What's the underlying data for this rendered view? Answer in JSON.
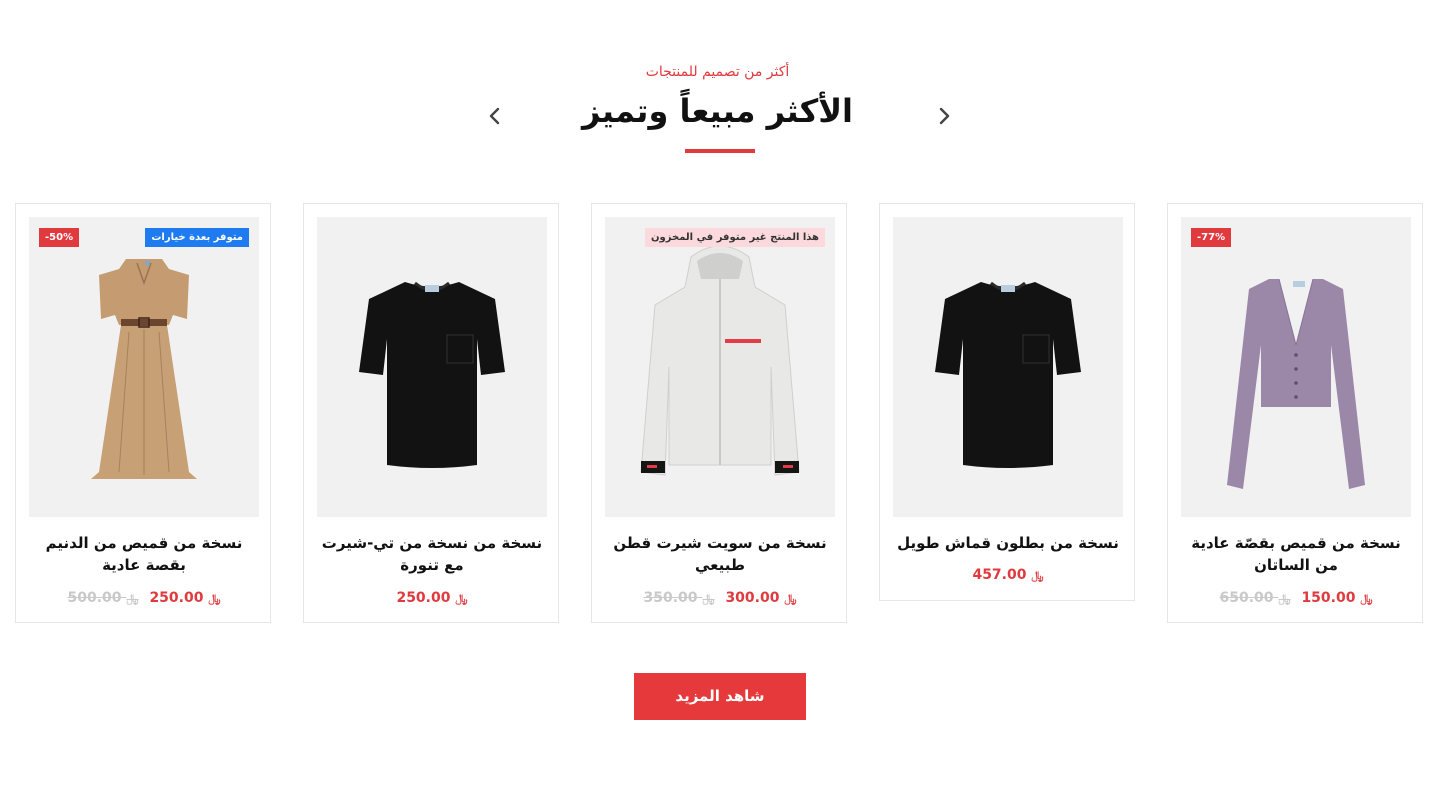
{
  "section": {
    "subtitle": "أكثر من تصميم للمنتجات",
    "title": "الأكثر مبيعاً وتميز",
    "see_more": "شاهد المزيد"
  },
  "colors": {
    "accent": "#e0393e",
    "option_badge": "#1e7cf0",
    "oos_badge": "#fbd9dc"
  },
  "currency_icon": "riyal-icon",
  "products": [
    {
      "name": "نسخة من قميص من الدنيم بقصة عادية",
      "discount_badge": "-50%",
      "tag_badge": "متوفر بعدة خيارات",
      "price": "250.00",
      "old_price": "500.00",
      "currency": "﷼",
      "image": "beige-dress"
    },
    {
      "name": "نسخة من نسخة من تي-شيرت مع تنورة",
      "discount_badge": "",
      "tag_badge": "",
      "price": "250.00",
      "old_price": "",
      "currency": "﷼",
      "image": "black-tshirt"
    },
    {
      "name": "نسخة من سويت شيرت قطن طبيعي",
      "discount_badge": "",
      "tag_badge": "هذا المنتج غير متوفر في المخزون",
      "price": "300.00",
      "old_price": "350.00",
      "currency": "﷼",
      "image": "white-jacket"
    },
    {
      "name": "نسخة من بطلون قماش طويل",
      "discount_badge": "",
      "tag_badge": "",
      "price": "457.00",
      "old_price": "",
      "currency": "﷼",
      "image": "black-tshirt"
    },
    {
      "name": "نسخة من قميص بقصّة عادية من الساتان",
      "discount_badge": "-77%",
      "tag_badge": "",
      "price": "150.00",
      "old_price": "650.00",
      "currency": "﷼",
      "image": "purple-cardigan"
    }
  ]
}
